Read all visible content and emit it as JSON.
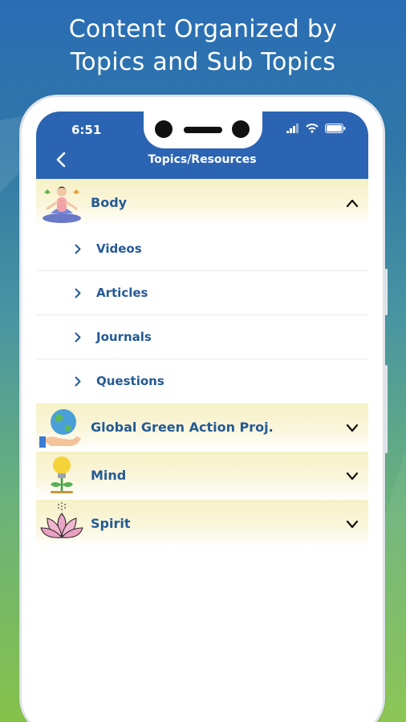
{
  "headline": {
    "line1": "Content Organized by",
    "line2": "Topics and Sub Topics"
  },
  "status_bar": {
    "time": "6:51",
    "icons": [
      "signal-icon",
      "wifi-icon",
      "battery-icon"
    ]
  },
  "nav": {
    "title": "Topics/Resources",
    "back_icon": "chevron-left-icon"
  },
  "topics": [
    {
      "label": "Body",
      "icon": "yoga-person-icon",
      "expanded": true,
      "subtopics": [
        "Videos",
        "Articles",
        "Journals",
        "Questions"
      ]
    },
    {
      "label": "Global Green Action Proj.",
      "icon": "globe-hand-icon",
      "expanded": false
    },
    {
      "label": "Mind",
      "icon": "lightbulb-plant-icon",
      "expanded": false
    },
    {
      "label": "Spirit",
      "icon": "lotus-icon",
      "expanded": false
    }
  ],
  "colors": {
    "header_blue": "#2b64b2",
    "label_blue": "#245a96",
    "topic_bg": "#f6f1c6"
  }
}
